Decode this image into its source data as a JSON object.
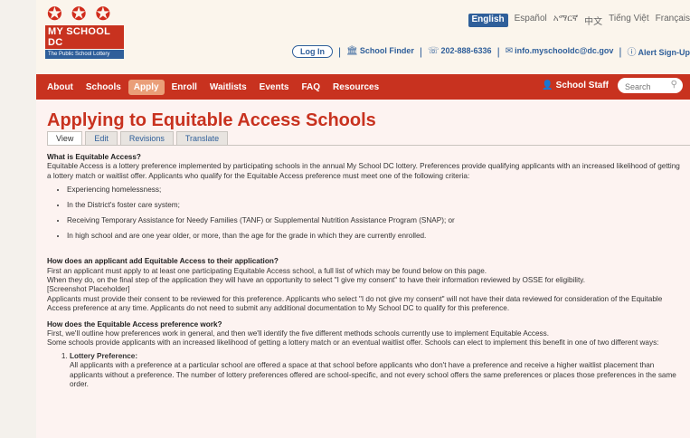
{
  "logo": {
    "main": "MY SCHOOL DC",
    "sub": "The Public School Lottery"
  },
  "languages": [
    "English",
    "Español",
    "አማርኛ",
    "中文",
    "Tiếng Việt",
    "Français"
  ],
  "util": {
    "login": "Log In",
    "school_finder": "School Finder",
    "phone": "202-888-6336",
    "email": "info.myschooldc@dc.gov",
    "alert": "Alert Sign-Up"
  },
  "nav": [
    "About",
    "Schools",
    "Apply",
    "Enroll",
    "Waitlists",
    "Events",
    "FAQ",
    "Resources"
  ],
  "nav_active": "Apply",
  "staff": "School Staff",
  "search": {
    "placeholder": "Search"
  },
  "page_title": "Applying to Equitable Access Schools",
  "tabs": [
    "View",
    "Edit",
    "Revisions",
    "Translate"
  ],
  "s1": {
    "q": "What is Equitable Access?",
    "p": "Equitable Access is a lottery preference implemented by participating schools in the annual My School DC lottery. Preferences provide qualifying applicants with an increased likelihood of getting a lottery match or waitlist offer. Applicants who qualify for the Equitable Access preference must meet one of the following criteria:",
    "items": [
      "Experiencing homelessness;",
      "In the District's foster care system;",
      "Receiving Temporary Assistance for Needy Families (TANF) or Supplemental Nutrition Assistance Program (SNAP); or",
      "In high school and are one year older, or more, than the age for the grade in which they are currently enrolled."
    ]
  },
  "s2": {
    "q": "How does an applicant add Equitable Access to their application?",
    "l1": "First an applicant must apply to at least one participating Equitable Access school, a full list of which may be found below on this page.",
    "l2": "When they do, on the final step of the application they will have an opportunity to select \"I give my consent\" to have their information reviewed by OSSE for eligibility.",
    "l3": "[Screenshot Placeholder]",
    "l4": "Applicants must provide their consent to be reviewed for this preference. Applicants who select \"I do not give my consent\" will not have their data reviewed for consideration of the Equitable Access preference at any time. Applicants do not need to submit any additional documentation to My School DC to qualify for this preference."
  },
  "s3": {
    "q": "How does the Equitable Access preference work?",
    "l1": "First, we'll outline how preferences work in general, and then we'll identify the five different methods schools currently use to implement Equitable Access.",
    "l2": "Some schools provide applicants with an increased likelihood of getting a lottery match or an eventual waitlist offer. Schools can elect to implement this benefit in one of two different ways:",
    "m1_title": "Lottery Preference:",
    "m1_text": "All applicants with a preference at a particular school are offered a space at that school before applicants who don't have a preference and receive a higher waitlist placement than applicants without a preference. The number of lottery preferences offered are school-specific, and not every school offers the same preferences or places those preferences in the same order."
  }
}
